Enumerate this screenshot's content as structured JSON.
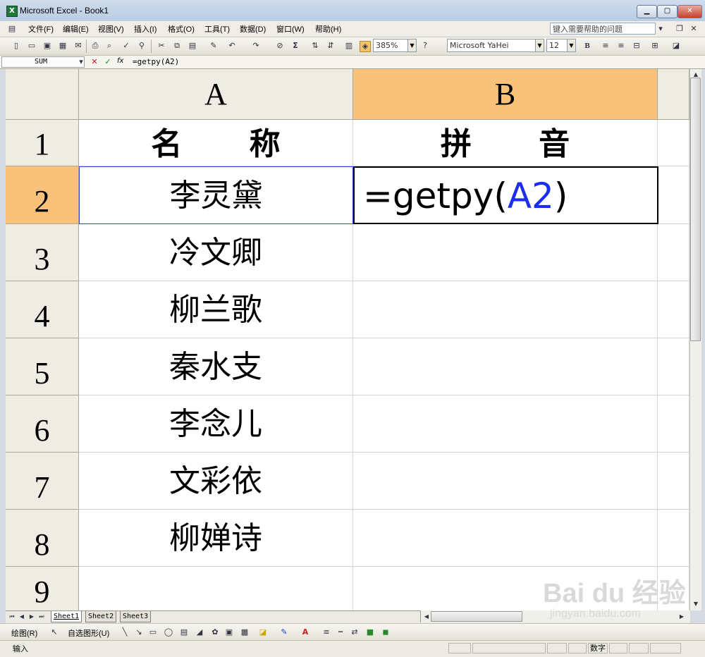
{
  "window": {
    "title": "Microsoft Excel - Book1",
    "app_icon": "excel-icon"
  },
  "menubar": {
    "items": [
      "文件(F)",
      "编辑(E)",
      "视图(V)",
      "插入(I)",
      "格式(O)",
      "工具(T)",
      "数据(D)",
      "窗口(W)",
      "帮助(H)"
    ],
    "help_placeholder": "键入需要帮助的问题"
  },
  "toolbar": {
    "zoom": "385%",
    "font": "Microsoft YaHei",
    "font_size": "12",
    "bold": "B",
    "sigma": "Σ"
  },
  "formula_bar": {
    "name_box": "SUM",
    "fx": "fx",
    "formula": "=getpy(A2)"
  },
  "grid": {
    "columns": [
      "A",
      "B"
    ],
    "rows": [
      "1",
      "2",
      "3",
      "4",
      "5",
      "6",
      "7",
      "8",
      "9"
    ],
    "selected_column": "B",
    "selected_row": "2",
    "header": {
      "a1": "名 称",
      "b1": "拼 音"
    },
    "names": [
      "李灵黛",
      "冷文卿",
      "柳兰歌",
      "秦水支",
      "李念儿",
      "文彩依",
      "柳婵诗"
    ],
    "edit": {
      "prefix": "=getpy(",
      "ref": "A2",
      "suffix": ")"
    },
    "selection_color": "#f8c27a",
    "ref_color": "#1b2ef0"
  },
  "sheets": [
    "Sheet1",
    "Sheet2",
    "Sheet3"
  ],
  "active_sheet": "Sheet1",
  "drawbar": {
    "draw": "绘图(R)",
    "autoshapes": "自选图形(U)"
  },
  "status": {
    "mode": "输入",
    "num": "数字"
  },
  "watermark": {
    "brand": "Bai du 经验",
    "url": "jingyan.baidu.com"
  }
}
